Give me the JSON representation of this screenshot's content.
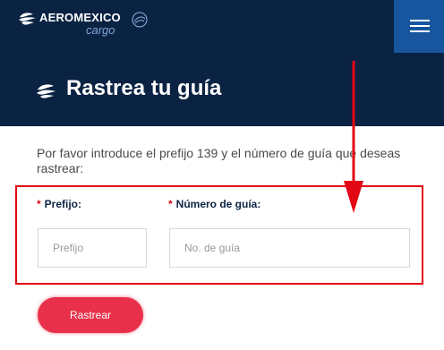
{
  "header": {
    "brand_name": "AEROMEXICO",
    "brand_sub": "cargo"
  },
  "banner": {
    "title": "Rastrea tu guía"
  },
  "intro": {
    "text": "Por favor introduce el prefijo 139 y el número de guía que deseas rastrear:"
  },
  "form": {
    "required_mark": "*",
    "prefix_label": "Prefijo:",
    "prefix_placeholder": "Prefijo",
    "guide_label": "Número de guía:",
    "guide_placeholder": "No. de guía",
    "submit_label": "Rastrear"
  },
  "colors": {
    "navy": "#0b2343",
    "menu_blue": "#17569e",
    "accent_red": "#e30613",
    "button_red": "#e8304a"
  },
  "icons": {
    "menu": "hamburger-icon",
    "logo": "aeromexico-logo-icon",
    "banner": "aeromexico-knight-icon",
    "annotation": "red-arrow-annotation"
  }
}
